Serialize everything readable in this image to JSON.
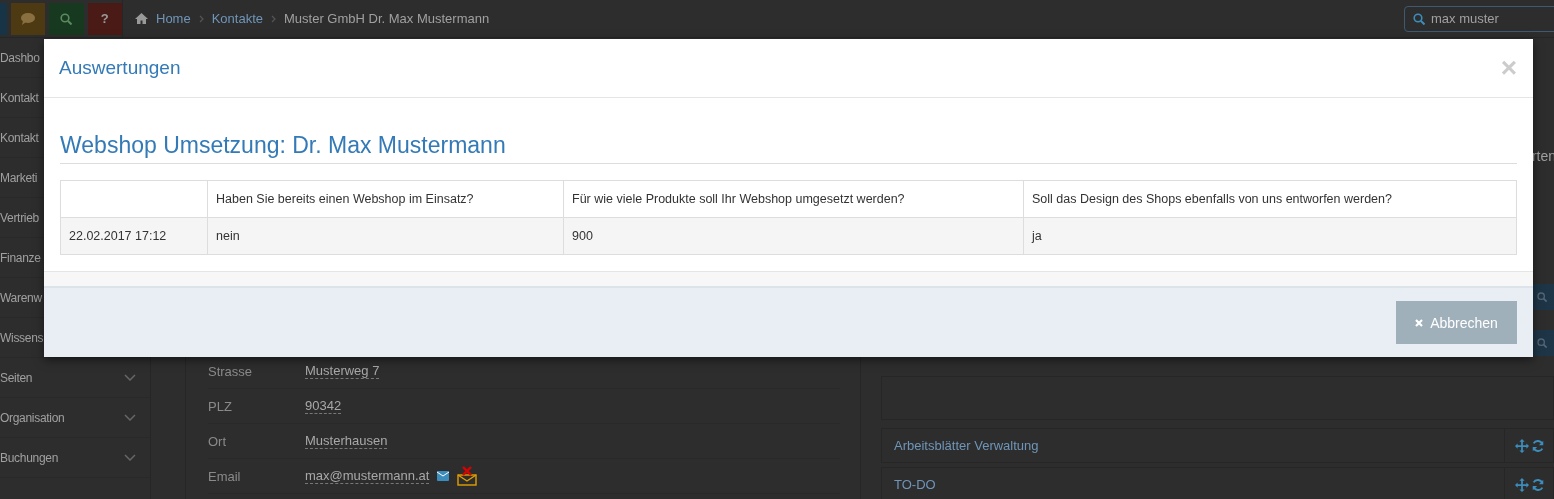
{
  "topbar": {
    "quick_buttons": [
      {
        "kind": "blank",
        "color": "#173447"
      },
      {
        "kind": "chat",
        "color": "#4d3a12"
      },
      {
        "kind": "search",
        "color": "#17391f"
      },
      {
        "kind": "help",
        "color": "#4a1a16",
        "label": "?"
      }
    ],
    "breadcrumb": [
      {
        "kind": "home",
        "label": "Home"
      },
      {
        "kind": "link",
        "label": "Kontakte"
      },
      {
        "kind": "current",
        "label": "Muster GmbH Dr. Max Mustermann"
      }
    ],
    "search": {
      "value": "max muster"
    }
  },
  "sidebar": {
    "items": [
      {
        "label": "Dashbo",
        "kind": "link"
      },
      {
        "label": "Kontakt",
        "kind": "link"
      },
      {
        "label": "Kontakt",
        "kind": "link"
      },
      {
        "label": "Marketi",
        "kind": "link"
      },
      {
        "label": "Vertrieb",
        "kind": "link"
      },
      {
        "label": "Finanze",
        "kind": "link"
      },
      {
        "label": "Warenw",
        "kind": "link"
      },
      {
        "label": "Wissens",
        "kind": "link"
      },
      {
        "label": "Seiten",
        "kind": "group"
      },
      {
        "label": "Organisation",
        "kind": "group"
      },
      {
        "label": "Buchungen",
        "kind": "group"
      }
    ]
  },
  "contact_fields": [
    {
      "label": "Strasse",
      "value": "Musterweg 7",
      "kind": "text"
    },
    {
      "label": "PLZ",
      "value": "90342",
      "kind": "text"
    },
    {
      "label": "Ort",
      "value": "Musterhausen",
      "kind": "text"
    },
    {
      "label": "Email",
      "value": "max@mustermann.at",
      "kind": "email"
    }
  ],
  "right_column": {
    "fragment": "rten",
    "panels": [
      {
        "title": "Arbeitsblätter Verwaltung"
      },
      {
        "title": "TO-DO"
      }
    ]
  },
  "modal": {
    "title": "Auswertungen",
    "close": "×",
    "heading": "Webshop Umsetzung: Dr. Max Mustermann",
    "table": {
      "columns": [
        "",
        "Haben Sie bereits einen Webshop im Einsatz?",
        "Für wie viele Produkte soll Ihr Webshop umgesetzt werden?",
        "Soll das Design des Shops ebenfalls von uns entworfen werden?"
      ],
      "rows": [
        [
          "22.02.2017 17:12",
          "nein",
          "900",
          "ja"
        ]
      ]
    },
    "cancel_button": {
      "label": "Abbrechen"
    }
  }
}
